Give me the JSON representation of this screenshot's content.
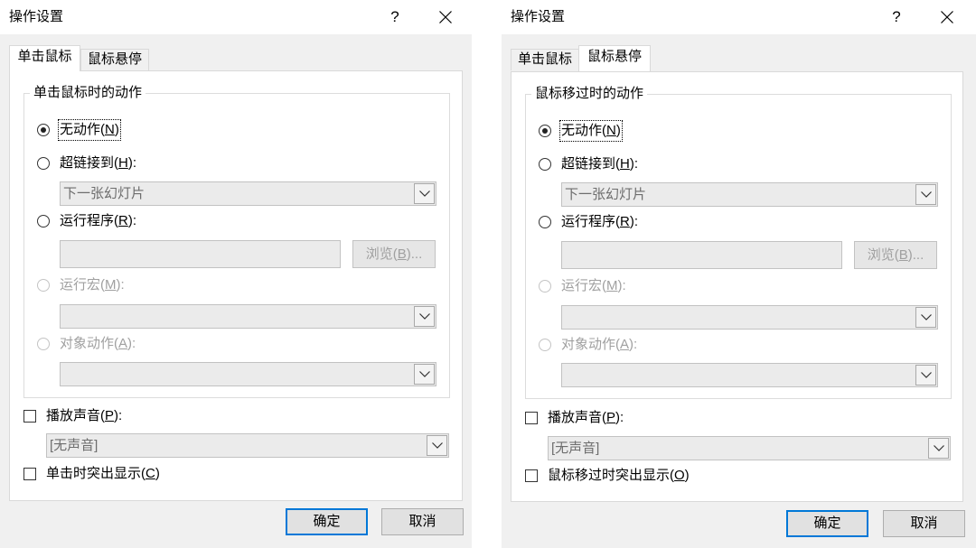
{
  "dialogs": [
    {
      "title": "操作设置",
      "help": "?",
      "tabs": [
        {
          "label": "单击鼠标",
          "selected": true
        },
        {
          "label": "鼠标悬停",
          "selected": false
        }
      ],
      "group_title": "单击鼠标时的动作",
      "radios": [
        {
          "label": "无动作(N)",
          "selected": true,
          "disabled": false
        },
        {
          "label": "超链接到(H):",
          "selected": false,
          "disabled": false
        },
        {
          "label": "运行程序(R):",
          "selected": false,
          "disabled": false
        },
        {
          "label": "运行宏(M):",
          "selected": false,
          "disabled": true
        },
        {
          "label": "对象动作(A):",
          "selected": false,
          "disabled": true
        }
      ],
      "hyperlink_target": "下一张幻灯片",
      "browse_label": "浏览(B)...",
      "play_sound": {
        "label": "播放声音(P):",
        "checked": false,
        "value": "[无声音]"
      },
      "highlight": {
        "label": "单击时突出显示(C)",
        "checked": false
      },
      "ok_label": "确定",
      "cancel_label": "取消"
    },
    {
      "title": "操作设置",
      "help": "?",
      "tabs": [
        {
          "label": "单击鼠标",
          "selected": false
        },
        {
          "label": "鼠标悬停",
          "selected": true
        }
      ],
      "group_title": "鼠标移过时的动作",
      "radios": [
        {
          "label": "无动作(N)",
          "selected": true,
          "disabled": false
        },
        {
          "label": "超链接到(H):",
          "selected": false,
          "disabled": false
        },
        {
          "label": "运行程序(R):",
          "selected": false,
          "disabled": false
        },
        {
          "label": "运行宏(M):",
          "selected": false,
          "disabled": true
        },
        {
          "label": "对象动作(A):",
          "selected": false,
          "disabled": true
        }
      ],
      "hyperlink_target": "下一张幻灯片",
      "browse_label": "浏览(B)...",
      "play_sound": {
        "label": "播放声音(P):",
        "checked": false,
        "value": "[无声音]"
      },
      "highlight": {
        "label": "鼠标移过时突出显示(O)",
        "checked": false
      },
      "ok_label": "确定",
      "cancel_label": "取消"
    }
  ],
  "colors": {
    "accent": "#0078d7",
    "dialog_background": "#f0f0f0",
    "disabled_text": "#a0a0a0"
  },
  "icons": {
    "close": "close-icon",
    "dropdown": "chevron-down-icon"
  }
}
